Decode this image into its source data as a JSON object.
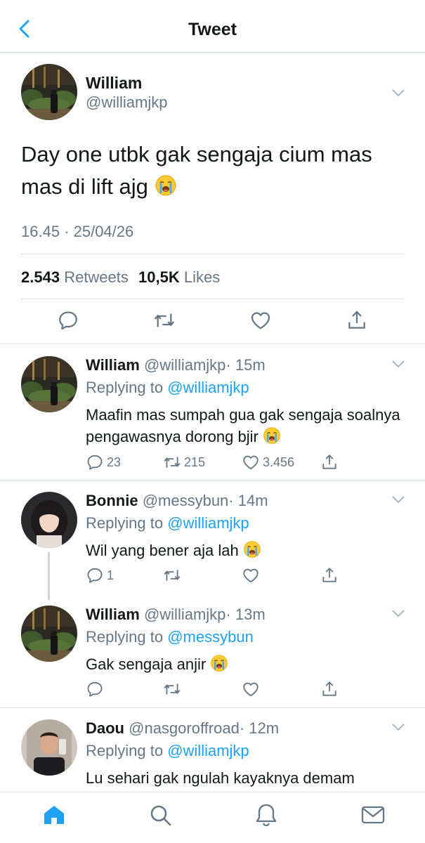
{
  "header": {
    "title": "Tweet"
  },
  "main_tweet": {
    "name": "William",
    "handle": "@williamjkp",
    "text": "Day one utbk gak sengaja cium mas mas di lift ajg",
    "timestamp": "16.45 · 25/04/26",
    "retweets_count": "2.543",
    "retweets_label": "Retweets",
    "likes_count": "10,5K",
    "likes_label": "Likes"
  },
  "replies": [
    {
      "name": "William",
      "handle": "@williamjkp",
      "time": "· 15m",
      "replying_label": "Replying to",
      "replying_to": "@williamjkp",
      "text": "Maafin mas sumpah gua gak sengaja soalnya pengawasnya dorong bjir",
      "replies": "23",
      "retweets": "215",
      "likes": "3.456"
    },
    {
      "name": "Bonnie",
      "handle": "@messybun",
      "time": "· 14m",
      "replying_label": "Replying to",
      "replying_to": "@williamjkp",
      "text": "Wil yang bener aja lah",
      "replies": "1",
      "retweets": "",
      "likes": ""
    },
    {
      "name": "William",
      "handle": "@williamjkp",
      "time": "· 13m",
      "replying_label": "Replying to",
      "replying_to": "@messybun",
      "text": "Gak sengaja anjir",
      "replies": "",
      "retweets": "",
      "likes": ""
    },
    {
      "name": "Daou",
      "handle": "@nasgoroffroad",
      "time": "· 12m",
      "replying_label": "Replying to",
      "replying_to": "@williamjkp",
      "text": "Lu sehari gak ngulah kayaknya demam"
    }
  ],
  "icons": {
    "back": "chevron-left-icon",
    "caret": "chevron-down-icon",
    "reply": "reply-icon",
    "retweet": "retweet-icon",
    "like": "heart-icon",
    "share": "share-icon",
    "home": "home-icon",
    "search": "search-icon",
    "notifications": "bell-icon",
    "messages": "mail-icon",
    "crying_emoji": "loudly-crying-face-emoji"
  },
  "colors": {
    "accent": "#1da1f2",
    "secondary_text": "#657786",
    "primary_text": "#14171a",
    "divider": "#d8dde1"
  }
}
